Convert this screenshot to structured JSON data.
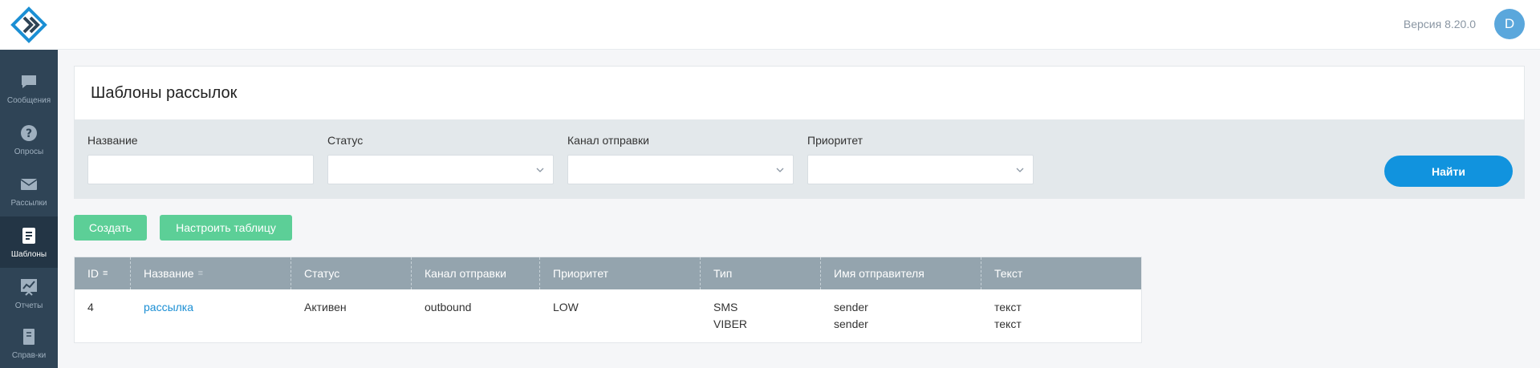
{
  "header": {
    "version": "Версия 8.20.0",
    "avatar_letter": "D"
  },
  "sidebar": {
    "items": [
      {
        "label": "Сообщения",
        "icon": "chat-icon"
      },
      {
        "label": "Опросы",
        "icon": "question-icon"
      },
      {
        "label": "Рассылки",
        "icon": "envelope-icon"
      },
      {
        "label": "Шаблоны",
        "icon": "template-icon",
        "active": true
      },
      {
        "label": "Отчеты",
        "icon": "report-icon"
      },
      {
        "label": "Справ-ки",
        "icon": "book-icon"
      }
    ]
  },
  "page": {
    "title": "Шаблоны рассылок"
  },
  "filters": {
    "name_label": "Название",
    "status_label": "Статус",
    "channel_label": "Канал отправки",
    "priority_label": "Приоритет",
    "name_value": "",
    "status_value": "",
    "channel_value": "",
    "priority_value": "",
    "find_label": "Найти"
  },
  "actions": {
    "create_label": "Создать",
    "configure_label": "Настроить таблицу"
  },
  "table": {
    "columns": [
      "ID",
      "Название",
      "Статус",
      "Канал отправки",
      "Приоритет",
      "Тип",
      "Имя отправителя",
      "Текст"
    ],
    "rows": [
      {
        "id": "4",
        "name": "рассылка",
        "status": "Активен",
        "channel": "outbound",
        "priority": "LOW",
        "types": [
          "SMS",
          "VIBER"
        ],
        "senders": [
          "sender",
          "sender"
        ],
        "texts": [
          "текст",
          "текст"
        ]
      }
    ]
  },
  "colors": {
    "sidebar": "#2f4456",
    "accent": "#1193de",
    "green": "#5ccf97",
    "table_header": "#94a4ae"
  }
}
